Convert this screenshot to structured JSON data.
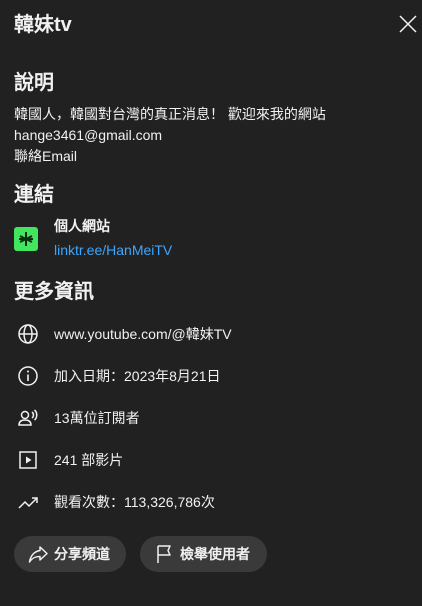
{
  "header": {
    "title": "韓妹tv"
  },
  "description": {
    "heading": "說明",
    "lines": [
      "韓國人，韓國對台灣的真正消息！ 歡迎來我的網站",
      "hange3461@gmail.com",
      "聯絡Email"
    ]
  },
  "links": {
    "heading": "連結",
    "items": [
      {
        "name": "個人網站",
        "url": "linktr.ee/HanMeiTV"
      }
    ]
  },
  "more_info": {
    "heading": "更多資訊",
    "url": "www.youtube.com/@韓妹TV",
    "joined": "加入日期：2023年8月21日",
    "subscribers": "13萬位訂閱者",
    "videos": "241 部影片",
    "views": "觀看次數：113,326,786次"
  },
  "actions": {
    "share_label": "分享頻道",
    "report_label": "檢舉使用者"
  },
  "colors": {
    "background": "#212121",
    "link": "#3ea6ff",
    "linktree_green": "#43e55e",
    "button_bg": "#3a3a3a"
  }
}
